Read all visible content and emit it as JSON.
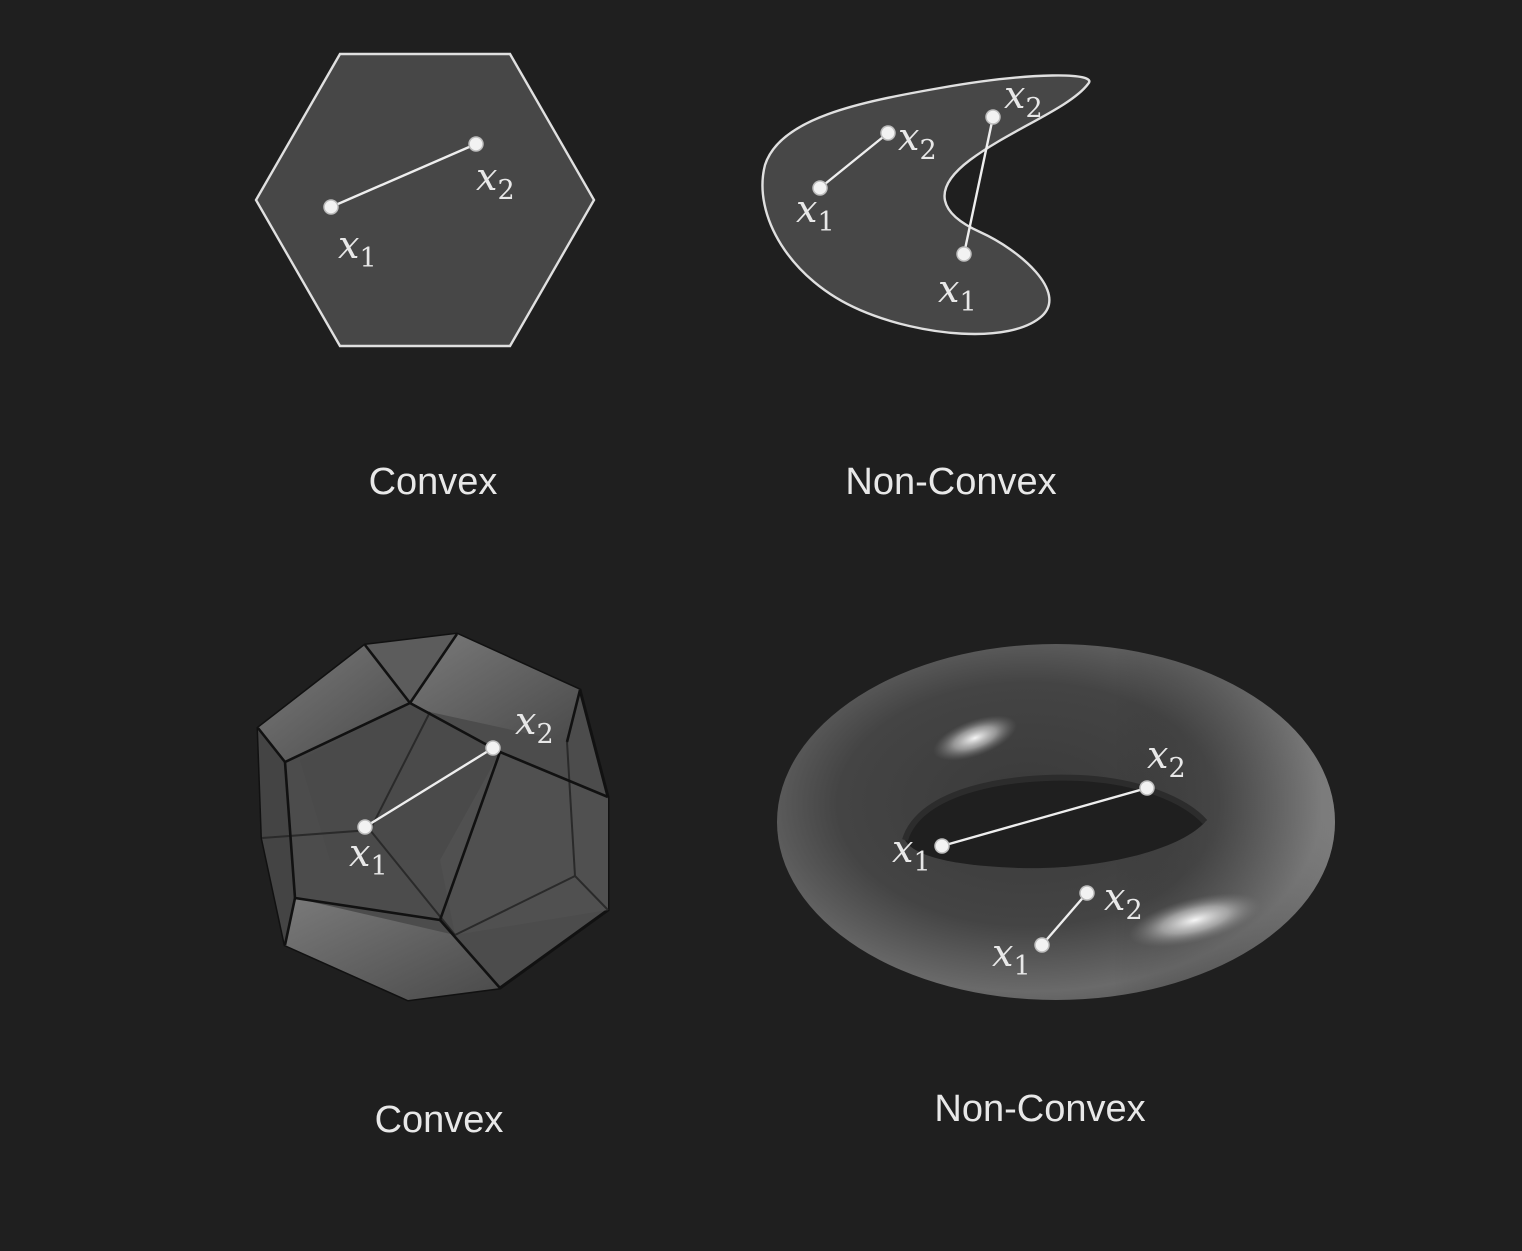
{
  "panels": [
    {
      "caption": "Convex",
      "labels": [
        {
          "var": "x",
          "sub": "1"
        },
        {
          "var": "x",
          "sub": "2"
        }
      ]
    },
    {
      "caption": "Non-Convex",
      "labels": [
        {
          "var": "x",
          "sub": "1"
        },
        {
          "var": "x",
          "sub": "2"
        },
        {
          "var": "x",
          "sub": "1"
        },
        {
          "var": "x",
          "sub": "2"
        }
      ]
    },
    {
      "caption": "Convex",
      "labels": [
        {
          "var": "x",
          "sub": "1"
        },
        {
          "var": "x",
          "sub": "2"
        }
      ]
    },
    {
      "caption": "Non-Convex",
      "labels": [
        {
          "var": "x",
          "sub": "1"
        },
        {
          "var": "x",
          "sub": "2"
        },
        {
          "var": "x",
          "sub": "1"
        },
        {
          "var": "x",
          "sub": "2"
        }
      ]
    }
  ],
  "colors": {
    "background": "#1f1f1f",
    "shape_fill": "#474747",
    "outline": "#e0e0e0",
    "text": "#e8e8e8"
  }
}
